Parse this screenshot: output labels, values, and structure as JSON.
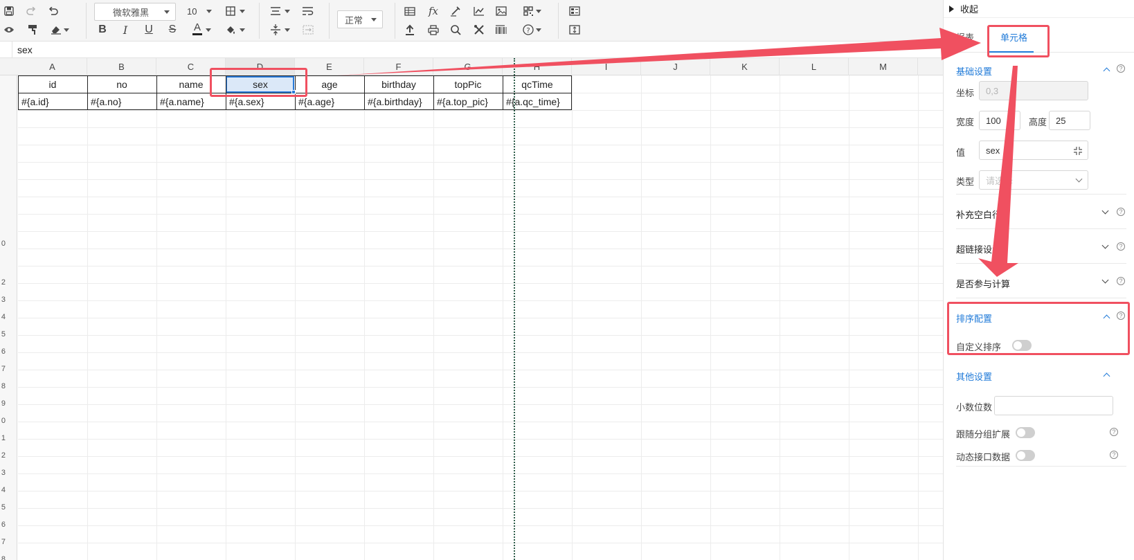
{
  "toolbar": {
    "font_family": "微软雅黑",
    "font_size": "10",
    "zoom_mode": "正常",
    "icons_row1": [
      "save-icon",
      "redo-icon",
      "undo-icon",
      "borders-icon",
      "align-icon",
      "wrap-icon",
      "table-icon",
      "formula-icon",
      "brush-icon",
      "chart-icon",
      "image-icon",
      "qrcode-icon",
      "split-icon"
    ],
    "icons_row2": [
      "eye-icon",
      "format-painter-icon",
      "eraser-icon",
      "bold-icon",
      "italic-icon",
      "underline-icon",
      "strikethrough-icon",
      "font-color-icon",
      "fill-color-icon",
      "vertical-align-icon",
      "merge-icon",
      "upload-icon",
      "print-icon",
      "search-icon",
      "tools-icon",
      "barcode-icon",
      "help-icon",
      "fit-icon"
    ]
  },
  "formula_bar": {
    "value": "sex"
  },
  "columns": [
    "A",
    "B",
    "C",
    "D",
    "E",
    "F",
    "G",
    "H",
    "I",
    "J",
    "K",
    "L",
    "M"
  ],
  "row_numbers": [
    "0",
    "2",
    "3",
    "4",
    "5",
    "6",
    "7",
    "8",
    "9",
    "0",
    "1",
    "2",
    "3",
    "4",
    "5",
    "6",
    "7",
    "8"
  ],
  "sheet": {
    "header_row": [
      "id",
      "no",
      "name",
      "sex",
      "age",
      "birthday",
      "topPic",
      "qcTime"
    ],
    "value_row": [
      "#{a.id}",
      "#{a.no}",
      "#{a.name}",
      "#{a.sex}",
      "#{a.age}",
      "#{a.birthday}",
      "#{a.top_pic}",
      "#{a.qc_time}"
    ]
  },
  "panel": {
    "collapse_label": "收起",
    "tabs": [
      {
        "label": "报表",
        "active": false
      },
      {
        "label": "单元格",
        "active": true
      }
    ],
    "basic": {
      "title": "基础设置",
      "coord_label": "坐标",
      "coord_value": "0,3",
      "width_label": "宽度",
      "width_value": "100",
      "height_label": "高度",
      "height_value": "25",
      "value_label": "值",
      "value_value": "sex",
      "type_label": "类型",
      "type_placeholder": "请选择"
    },
    "sections": {
      "blank_rows": "补充空白行",
      "hyperlink": "超链接设置",
      "calc": "是否参与计算"
    },
    "sort": {
      "title": "排序配置",
      "custom_label": "自定义排序",
      "custom_enabled": false
    },
    "other": {
      "title": "其他设置",
      "decimal_label": "小数位数",
      "decimal_value": "",
      "group_expand_label": "跟随分组扩展",
      "group_expand_enabled": false,
      "dynamic_label": "动态接口数据",
      "dynamic_enabled": false
    }
  },
  "colors": {
    "accent": "#1f7ad8",
    "annotation": "#f05060",
    "selection": "#dbe8f8"
  }
}
